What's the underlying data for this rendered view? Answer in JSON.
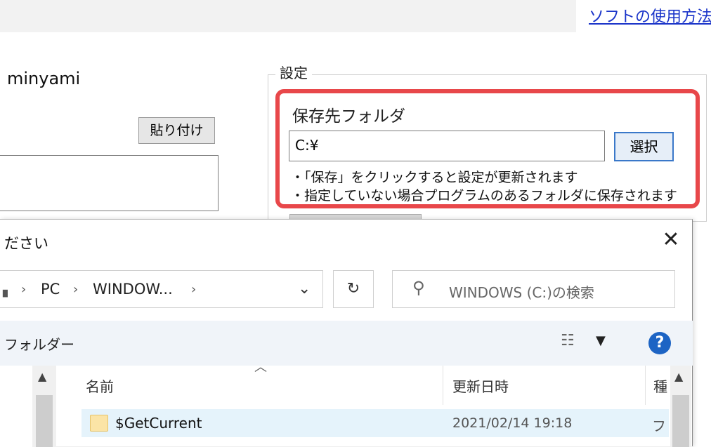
{
  "header": {
    "help_link": "ソフトの使用方法"
  },
  "main": {
    "user_name": "minyami",
    "paste_button": "貼り付け"
  },
  "settings": {
    "legend": "設定",
    "folder_label": "保存先フォルダ",
    "path_value": "C:¥",
    "select_button": "選択",
    "note1": "・「保存」をクリックすると設定が更新されます",
    "note2": "・指定していない場合プログラムのあるフォルダに保存されます"
  },
  "dialog": {
    "title": "ださい",
    "address": {
      "seg1": "PC",
      "seg2": "WINDOW..."
    },
    "search_placeholder": "WINDOWS (C:)の検索",
    "toolbar": {
      "new_folder": "フォルダー"
    },
    "columns": {
      "name": "名前",
      "date": "更新日時",
      "type": "種"
    },
    "rows": [
      {
        "name": "$GetCurrent",
        "date": "2021/02/14 19:18",
        "type": "フ"
      }
    ]
  },
  "colors": {
    "highlight": "#e8474a",
    "link": "#1a34c9",
    "selected_row": "#e5f3fb",
    "help_icon": "#1d64c4"
  },
  "icons": [
    "close-icon",
    "chevron-down-icon",
    "refresh-icon",
    "search-icon",
    "view-options-icon",
    "help-icon",
    "folder-icon",
    "scroll-up-icon"
  ]
}
